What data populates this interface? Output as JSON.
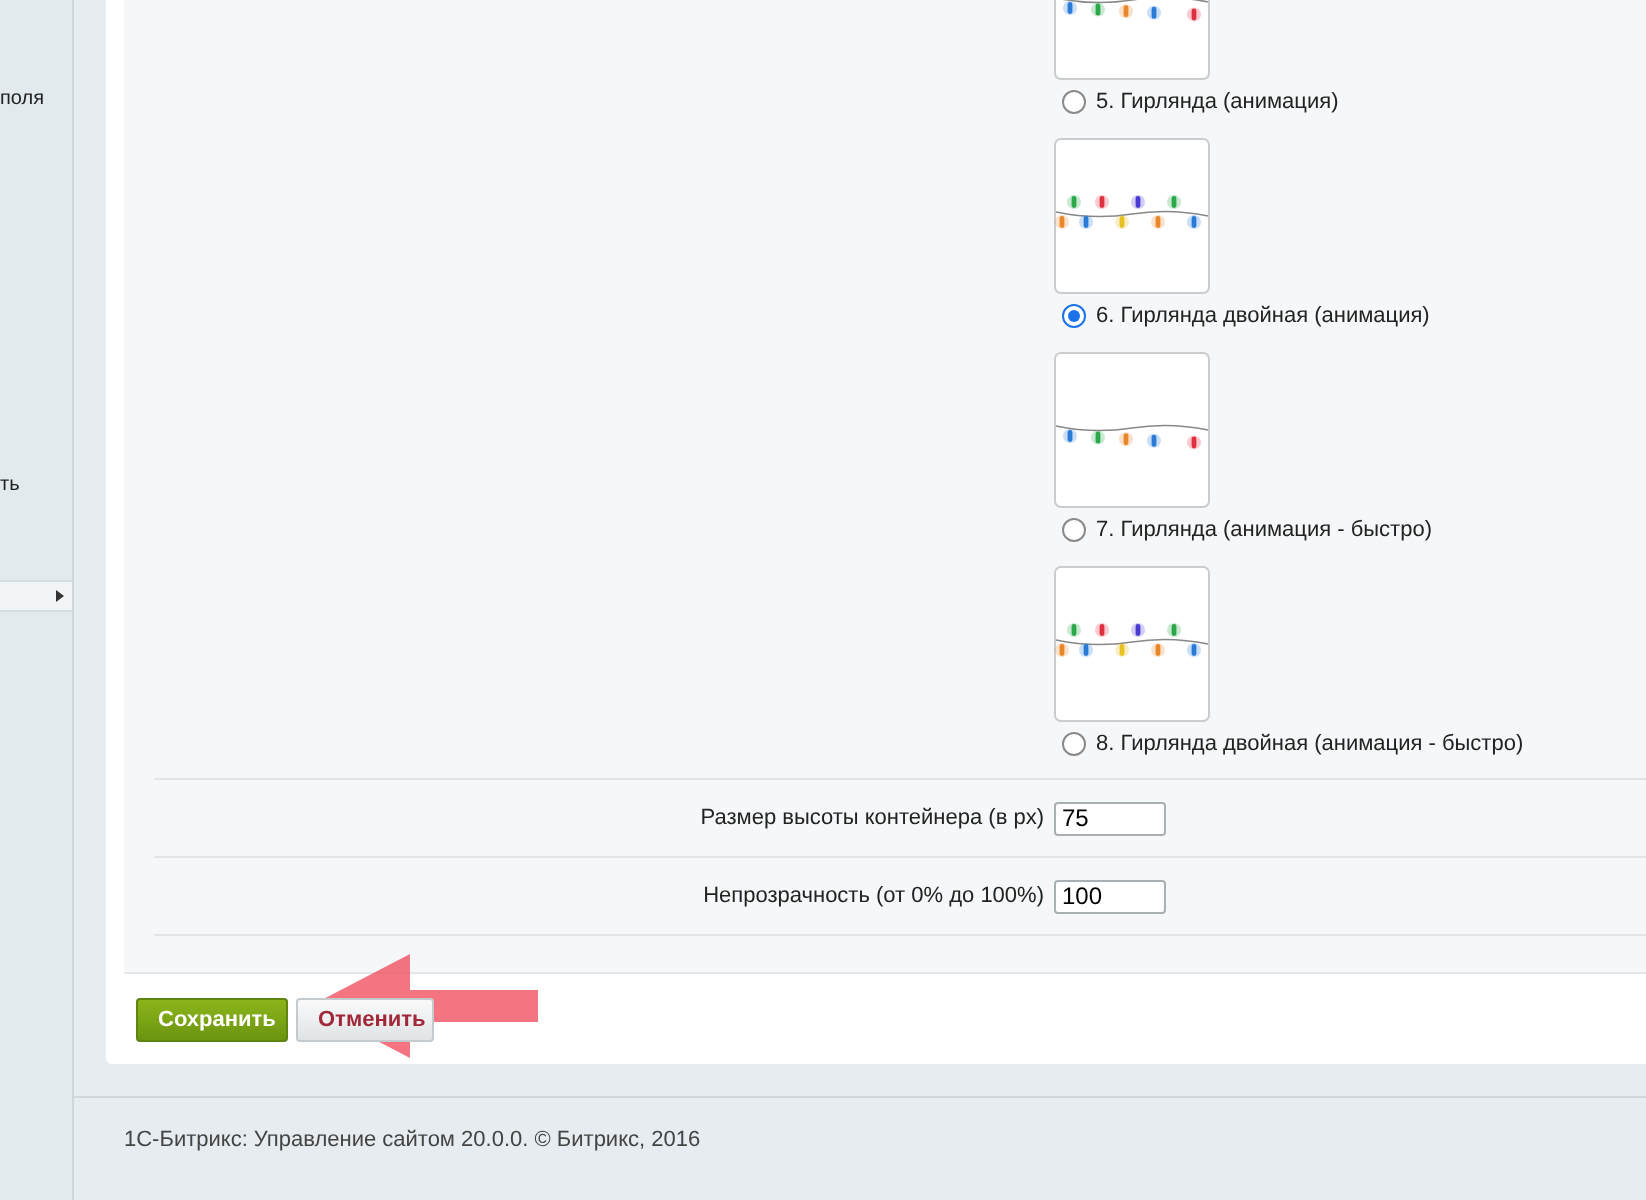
{
  "sidebar": {
    "texts": [
      "поля",
      "ть"
    ]
  },
  "options": [
    {
      "label": "5. Гирлянда (анимация)",
      "kind": "single",
      "selected": false
    },
    {
      "label": "6. Гирлянда двойная (анимация)",
      "kind": "double",
      "selected": true
    },
    {
      "label": "7. Гирлянда (анимация - быстро)",
      "kind": "single",
      "selected": false
    },
    {
      "label": "8. Гирлянда двойная (анимация - быстро)",
      "kind": "double",
      "selected": false
    }
  ],
  "fields": [
    {
      "label": "Размер высоты контейнера (в px)",
      "value": "75"
    },
    {
      "label": "Непрозрачность (от 0% до 100%)",
      "value": "100"
    }
  ],
  "buttons": [
    {
      "label": "Сохранить",
      "kind": "primary"
    },
    {
      "label": "Отменить",
      "kind": "secondary"
    }
  ],
  "footer": "1С-Битрикс: Управление сайтом 20.0.0. © Битрикс, 2016"
}
